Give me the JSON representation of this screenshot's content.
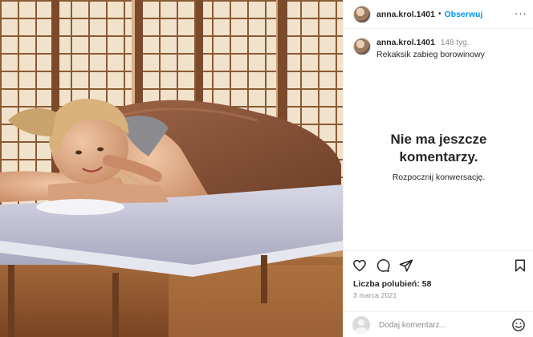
{
  "post_header": {
    "username": "anna.krol.1401",
    "separator": "•",
    "follow_label": "Obserwuj",
    "more_label": "···"
  },
  "caption": {
    "username": "anna.krol.1401",
    "time_ago": "148 tyg.",
    "text": "Rekaksik zabieg borowinowy"
  },
  "comments_empty": {
    "title": "Nie ma jeszcze komentarzy.",
    "subtitle": "Rozpocznij konwersację."
  },
  "actions": {
    "icons": [
      "heart-icon",
      "comment-icon",
      "share-icon",
      "bookmark-icon"
    ],
    "likes_text": "Liczba polubień: 58",
    "date": "3 marca 2021"
  },
  "comment_input": {
    "placeholder": "Dodaj komentarz...",
    "emoji_icon": "smiley-icon"
  },
  "colors": {
    "accent": "#0095f6",
    "text": "#262626",
    "muted": "#8e8e8e",
    "border": "#efefef"
  }
}
